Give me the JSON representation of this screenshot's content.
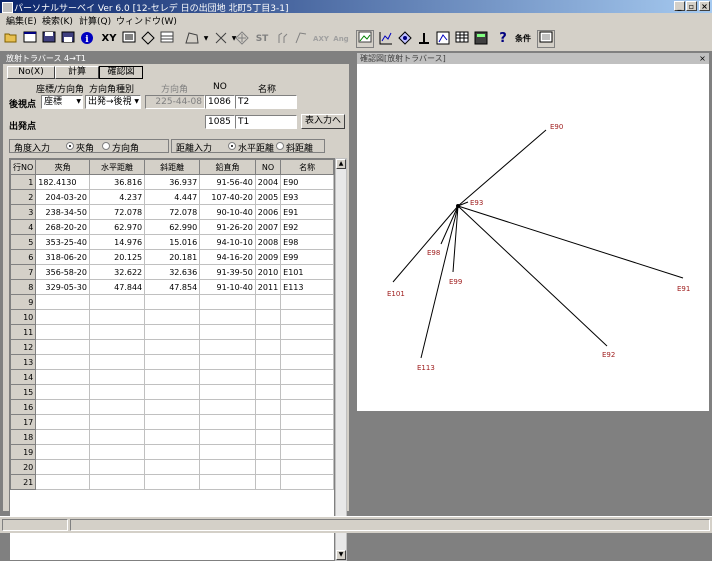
{
  "app": {
    "title": "パーソナルサーベイ Ver 6.0 [12-セレデ 日の出団地 北町5丁目3-1]"
  },
  "menu": [
    "編集(E)",
    "検索(K)",
    "計算(Q)",
    "ウィンドウ(W)"
  ],
  "toolbar": {
    "xy": "XY",
    "st": "ST",
    "axy": "AXY",
    "ang": "Ang",
    "settings": "条件",
    "help": "?"
  },
  "panel": {
    "title": "放射トラバース 4→T1",
    "no_button": "No(X)",
    "calc_button": "計算",
    "confirm_button": "確認図",
    "coord_dir_label": "座標/方向角",
    "dir_type_label": "方向角種別",
    "dir_label": "方向角",
    "no_label": "NO",
    "name_label": "名称",
    "backsight_label": "後視点",
    "backsight": {
      "type": "座標",
      "dir_type": "出発→後視",
      "angle": "225-44-08",
      "no": "1086",
      "name": "T2"
    },
    "start_label": "出発点",
    "start": {
      "no": "1085",
      "name": "T1"
    },
    "table_input_button": "表入力へ",
    "angle_input_label": "角度入力",
    "angle_opt1": "夾角",
    "angle_opt2": "方向角",
    "dist_input_label": "距離入力",
    "dist_opt1": "水平距離",
    "dist_opt2": "斜距離",
    "table": {
      "headers": [
        "行NO",
        "夾角",
        "水平距離",
        "斜距離",
        "鉛直角",
        "NO",
        "名称"
      ],
      "rows": [
        [
          "1",
          "182.4130",
          "36.816",
          "36.937",
          "91-56-40",
          "2004",
          "E90"
        ],
        [
          "2",
          "204-03-20",
          "4.237",
          "4.447",
          "107-40-20",
          "2005",
          "E93"
        ],
        [
          "3",
          "238-34-50",
          "72.078",
          "72.078",
          "90-10-40",
          "2006",
          "E91"
        ],
        [
          "4",
          "268-20-20",
          "62.970",
          "62.990",
          "91-26-20",
          "2007",
          "E92"
        ],
        [
          "5",
          "353-25-40",
          "14.976",
          "15.016",
          "94-10-10",
          "2008",
          "E98"
        ],
        [
          "6",
          "318-06-20",
          "20.125",
          "20.181",
          "94-16-20",
          "2009",
          "E99"
        ],
        [
          "7",
          "356-58-20",
          "32.622",
          "32.636",
          "91-39-50",
          "2010",
          "E101"
        ],
        [
          "8",
          "329-05-30",
          "47.844",
          "47.854",
          "91-10-40",
          "2011",
          "E113"
        ],
        [
          "9",
          "",
          "",
          "",
          "",
          "",
          ""
        ],
        [
          "10",
          "",
          "",
          "",
          "",
          "",
          ""
        ],
        [
          "11",
          "",
          "",
          "",
          "",
          "",
          ""
        ],
        [
          "12",
          "",
          "",
          "",
          "",
          "",
          ""
        ],
        [
          "13",
          "",
          "",
          "",
          "",
          "",
          ""
        ],
        [
          "14",
          "",
          "",
          "",
          "",
          "",
          ""
        ],
        [
          "15",
          "",
          "",
          "",
          "",
          "",
          ""
        ],
        [
          "16",
          "",
          "",
          "",
          "",
          "",
          ""
        ],
        [
          "17",
          "",
          "",
          "",
          "",
          "",
          ""
        ],
        [
          "18",
          "",
          "",
          "",
          "",
          "",
          ""
        ],
        [
          "19",
          "",
          "",
          "",
          "",
          "",
          ""
        ],
        [
          "20",
          "",
          "",
          "",
          "",
          "",
          ""
        ],
        [
          "21",
          "",
          "",
          "",
          "",
          "",
          ""
        ]
      ]
    }
  },
  "diagram": {
    "title": "確認図[放射トラバース]",
    "points": [
      "E90",
      "E93",
      "E98",
      "E99",
      "E101",
      "E91",
      "E92",
      "E113"
    ]
  }
}
